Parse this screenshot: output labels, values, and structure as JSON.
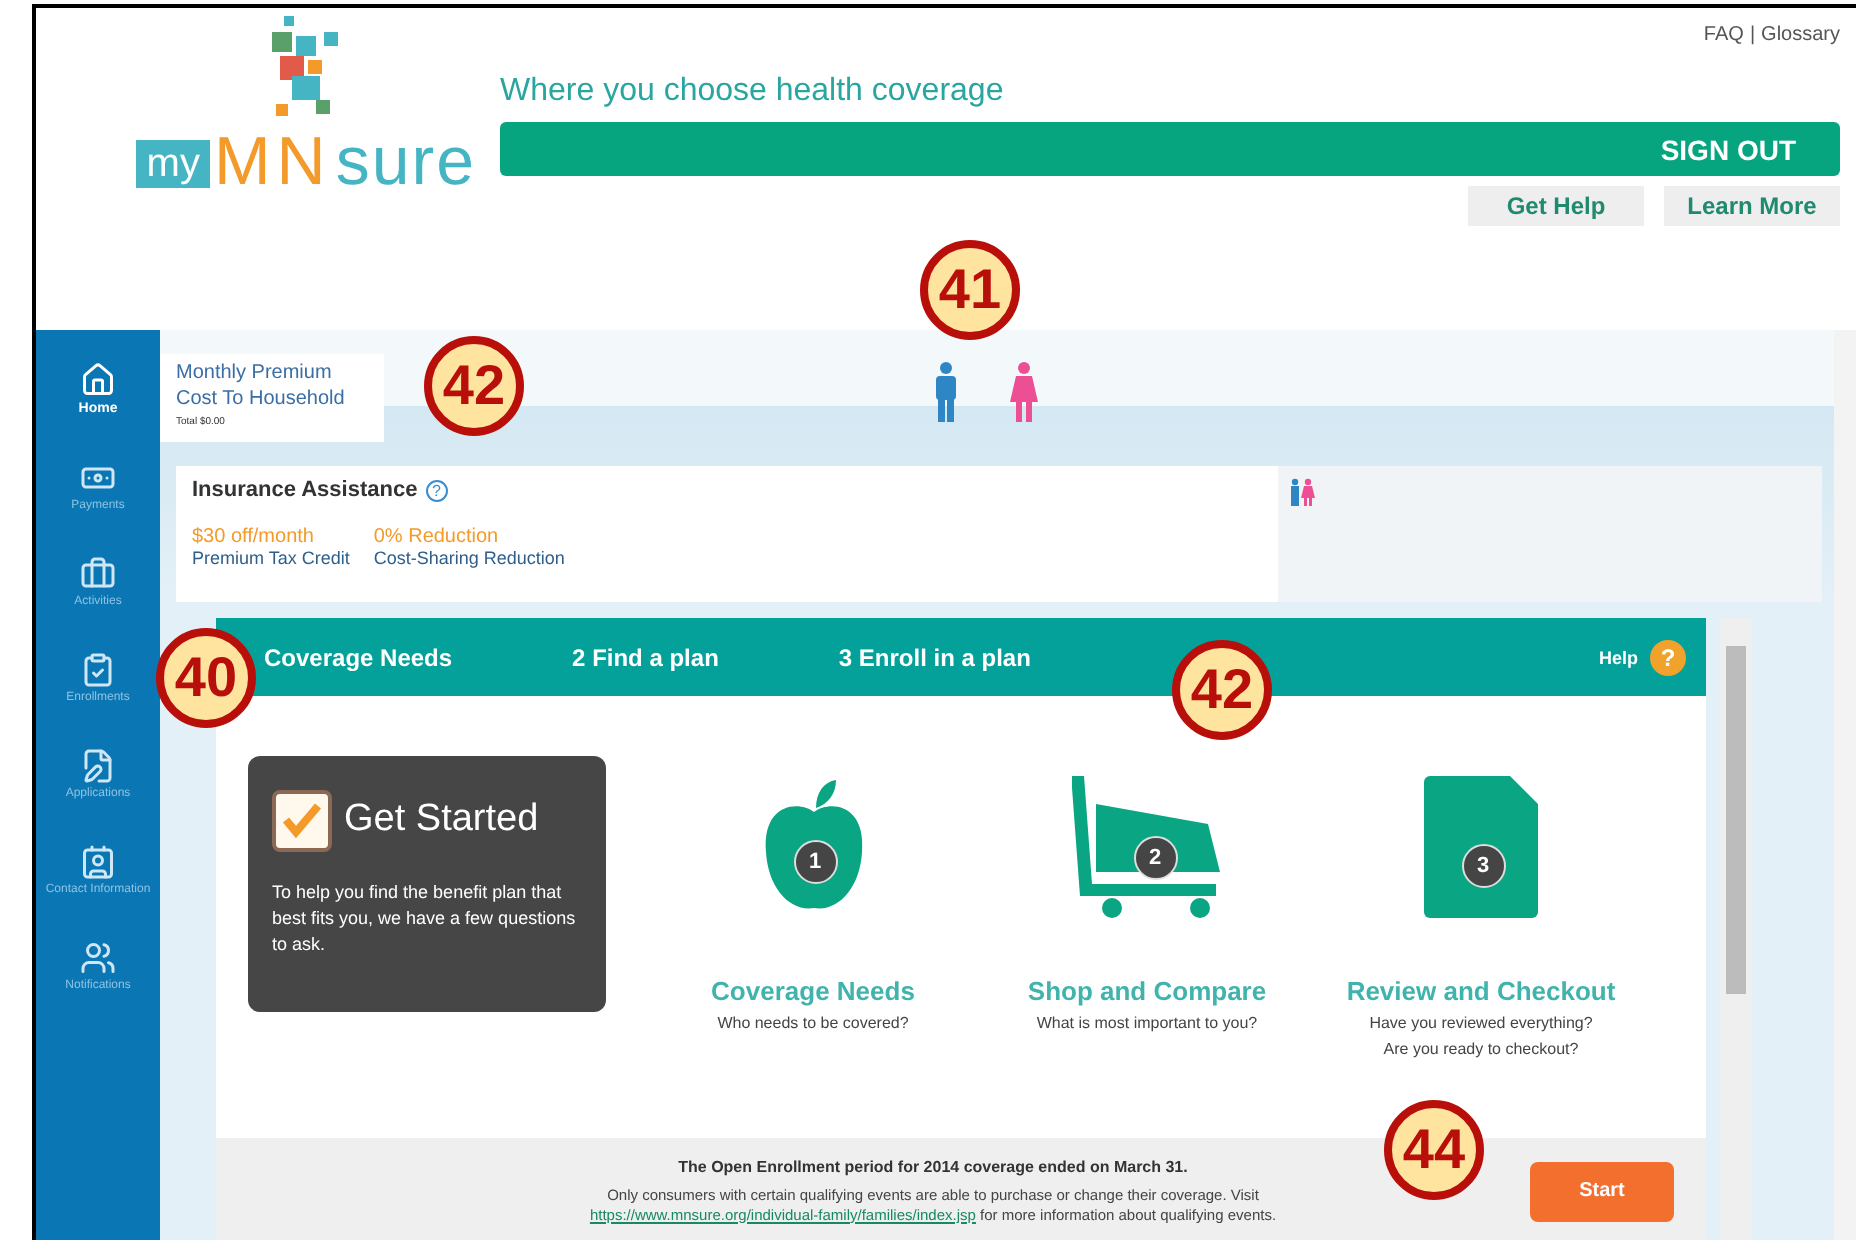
{
  "header": {
    "links": [
      "FAQ",
      "Glossary"
    ],
    "link_separator": "|",
    "logo": {
      "prefix": "my",
      "main": "MN",
      "suffix": "sure"
    },
    "tagline": "Where you choose health coverage",
    "sign_out": "SIGN OUT",
    "buttons": [
      "Get Help",
      "Learn More"
    ]
  },
  "sidebar": {
    "items": [
      {
        "label": "Home",
        "selected": true
      },
      {
        "label": "Payments",
        "selected": false
      },
      {
        "label": "Activities",
        "selected": false
      },
      {
        "label": "Enrollments",
        "selected": false
      },
      {
        "label": "Applications",
        "selected": false
      },
      {
        "label": "Contact Information",
        "selected": false
      },
      {
        "label": "Notifications",
        "selected": false
      }
    ]
  },
  "premium": {
    "title_lines": [
      "Monthly Premium",
      "Cost To Household"
    ],
    "total": "Total $0.00"
  },
  "household": {
    "members": [
      {
        "kind": "male"
      },
      {
        "kind": "female"
      }
    ]
  },
  "assistance": {
    "title": "Insurance Assistance",
    "help": "?",
    "items": [
      {
        "value": "$30 off/month",
        "label": "Premium Tax Credit"
      },
      {
        "value": "0% Reduction",
        "label": "Cost-Sharing Reduction"
      }
    ]
  },
  "wizard": {
    "steps": [
      {
        "label": "Coverage Needs"
      },
      {
        "number": "2",
        "label": "Find a plan"
      },
      {
        "number": "3",
        "label": "Enroll in a plan"
      }
    ],
    "help": "Help",
    "help_icon": "?",
    "get_started": {
      "title": "Get Started",
      "text": "To help you find the benefit plan that best fits you, we have a few questions to ask."
    },
    "stages": [
      {
        "kind": "apple",
        "number": "1",
        "title": "Coverage Needs",
        "subtitle": [
          "Who needs to be covered?"
        ]
      },
      {
        "kind": "cart",
        "number": "2",
        "title": "Shop and Compare",
        "subtitle": [
          "What is most important to you?"
        ]
      },
      {
        "kind": "document",
        "number": "3",
        "title": "Review and Checkout",
        "subtitle": [
          "Have you reviewed everything?",
          "Are you ready to checkout?"
        ]
      }
    ],
    "notice": "The Open Enrollment period for 2014 coverage ended on March 31.",
    "info_before": "Only consumers with certain qualifying events are able to purchase or change their coverage. Visit",
    "info_link": "https://www.mnsure.org/individual-family/families/index.jsp",
    "info_after": "for more information about qualifying events.",
    "start": "Start"
  },
  "callouts": [
    {
      "number": "41"
    },
    {
      "number": "42"
    },
    {
      "number": "40"
    },
    {
      "number": "42"
    },
    {
      "number": "44"
    }
  ]
}
